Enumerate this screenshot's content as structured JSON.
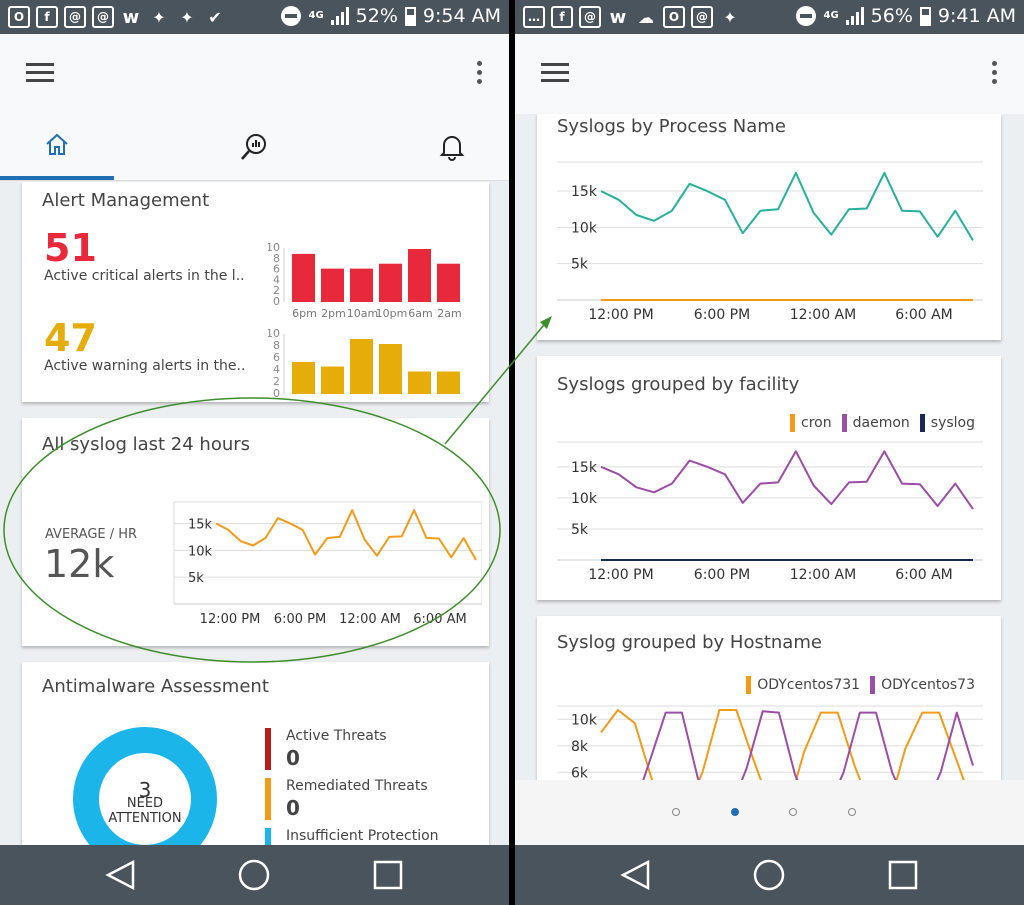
{
  "left": {
    "status": {
      "battery": "52%",
      "time": "9:54 AM",
      "network": "4G"
    },
    "alert_card": {
      "title": "Alert Management",
      "critical": {
        "count": "51",
        "label": "Active critical alerts in the l...",
        "color": "#e8293b"
      },
      "warning": {
        "count": "47",
        "label": "Active warning alerts in the...",
        "color": "#e6ad0a"
      }
    },
    "syslog_card": {
      "title": "All syslog last 24 hours",
      "avg_label": "AVERAGE / HR",
      "avg_value": "12k"
    },
    "antimalware": {
      "title": "Antimalware Assessment",
      "ring_count": "3",
      "ring_label1": "NEED",
      "ring_label2": "ATTENTION",
      "threats": [
        {
          "label": "Active Threats",
          "value": "0",
          "color": "#b71c1c"
        },
        {
          "label": "Remediated Threats",
          "value": "0",
          "color": "#f39a1b"
        },
        {
          "label": "Insufficient Protection",
          "value": "",
          "color": "#1cb5ea"
        }
      ]
    }
  },
  "right": {
    "status": {
      "battery": "56%",
      "time": "9:41 AM",
      "network": "4G"
    },
    "card1": {
      "title": "Syslogs by Process Name"
    },
    "card2": {
      "title": "Syslogs grouped by facility",
      "legend": [
        "cron",
        "daemon",
        "syslog"
      ]
    },
    "card3": {
      "title": "Syslog grouped by Hostname",
      "legend": [
        "ODYcentos731",
        "ODYcentos73"
      ]
    }
  },
  "colors": {
    "teal": "#27b09a",
    "orange": "#f39a1b",
    "purple": "#9b4ea6",
    "navy": "#1a2a4e",
    "accent": "#1f6fb4"
  },
  "chart_data": [
    {
      "type": "bar",
      "series": [
        {
          "name": "",
          "values": [
            9.8,
            6.8,
            6.8,
            7.8,
            10.8,
            7.8
          ]
        }
      ],
      "categories": [
        "6pm",
        "2pm",
        "10am",
        "10pm",
        "6am",
        "2am"
      ],
      "yticks": [
        "10",
        "8",
        "6",
        "4",
        "2",
        "0"
      ],
      "ylim": [
        0,
        11
      ],
      "color": "#e8293b"
    },
    {
      "type": "bar",
      "series": [
        {
          "name": "",
          "values": [
            6.4,
            5.5,
            11,
            10,
            4.5,
            4.5
          ]
        }
      ],
      "yticks": [
        "10",
        "8",
        "6",
        "4",
        "2",
        "0"
      ],
      "ylim": [
        0,
        12
      ],
      "color": "#e6ad0a"
    },
    {
      "type": "line",
      "x_ticks": [
        "12:00 PM",
        "6:00 PM",
        "12:00 AM",
        "6:00 AM"
      ],
      "y_ticks": [
        "15k",
        "10k",
        "5k"
      ],
      "ylim": [
        0,
        19000
      ],
      "series": [
        {
          "name": "",
          "color": "#f39a1b",
          "values": [
            15000,
            13800,
            11700,
            10900,
            12300,
            16000,
            15000,
            13800,
            9200,
            12300,
            12500,
            17500,
            12000,
            9000,
            12500,
            12600,
            17500,
            12300,
            12200,
            8700,
            12300,
            8200
          ]
        }
      ]
    },
    {
      "type": "line",
      "title": "Syslogs by Process Name",
      "x_ticks": [
        "12:00 PM",
        "6:00 PM",
        "12:00 AM",
        "6:00 AM"
      ],
      "y_ticks": [
        "15k",
        "10k",
        "5k"
      ],
      "ylim": [
        0,
        19000
      ],
      "series": [
        {
          "name": "",
          "color": "#27b09a",
          "values": [
            15000,
            13800,
            11700,
            10900,
            12300,
            16000,
            15000,
            13800,
            9200,
            12300,
            12500,
            17500,
            12000,
            9000,
            12500,
            12600,
            17500,
            12300,
            12200,
            8700,
            12300,
            8200
          ]
        },
        {
          "name": "",
          "color": "#f39a1b",
          "values": [
            0,
            0,
            0,
            0,
            0,
            0,
            0,
            0,
            0,
            0,
            0,
            0,
            0,
            0,
            0,
            0,
            0,
            0,
            0,
            0,
            0,
            0
          ]
        }
      ]
    },
    {
      "type": "line",
      "title": "Syslogs grouped by facility",
      "x_ticks": [
        "12:00 PM",
        "6:00 PM",
        "12:00 AM",
        "6:00 AM"
      ],
      "y_ticks": [
        "15k",
        "10k",
        "5k"
      ],
      "ylim": [
        0,
        19000
      ],
      "series": [
        {
          "name": "cron",
          "color": "#f39a1b",
          "values": [
            0,
            0,
            0,
            0,
            0,
            0,
            0,
            0,
            0,
            0,
            0,
            0,
            0,
            0,
            0,
            0,
            0,
            0,
            0,
            0,
            0,
            0
          ]
        },
        {
          "name": "daemon",
          "color": "#9b4ea6",
          "values": [
            15000,
            13800,
            11700,
            10900,
            12300,
            16000,
            15000,
            13800,
            9200,
            12300,
            12500,
            17500,
            12000,
            9000,
            12500,
            12600,
            17500,
            12300,
            12200,
            8700,
            12300,
            8200
          ]
        },
        {
          "name": "syslog",
          "color": "#1a2a4e",
          "values": [
            0,
            0,
            0,
            0,
            0,
            0,
            0,
            0,
            0,
            0,
            0,
            0,
            0,
            0,
            0,
            0,
            0,
            0,
            0,
            0,
            0,
            0
          ]
        }
      ]
    },
    {
      "type": "line",
      "title": "Syslog grouped by Hostname",
      "y_ticks": [
        "10k",
        "8k",
        "6k"
      ],
      "ylim": [
        3000,
        11000
      ],
      "series": [
        {
          "name": "ODYcentos731",
          "color": "#f39a1b",
          "values": [
            9000,
            10700,
            9700,
            5500,
            3000,
            3000,
            6000,
            10700,
            10700,
            7000,
            3500,
            3000,
            7500,
            10500,
            10500,
            6500,
            3200,
            3200,
            7800,
            10500,
            10500,
            7000,
            3500
          ]
        },
        {
          "name": "ODYcentos73",
          "color": "#9b4ea6",
          "values": [
            4000,
            3200,
            3200,
            6800,
            10500,
            10500,
            5500,
            3200,
            3200,
            6300,
            10600,
            10500,
            5800,
            3200,
            3200,
            6000,
            10500,
            10500,
            6000,
            3200,
            3200,
            6000,
            10500,
            6500
          ]
        }
      ]
    }
  ]
}
